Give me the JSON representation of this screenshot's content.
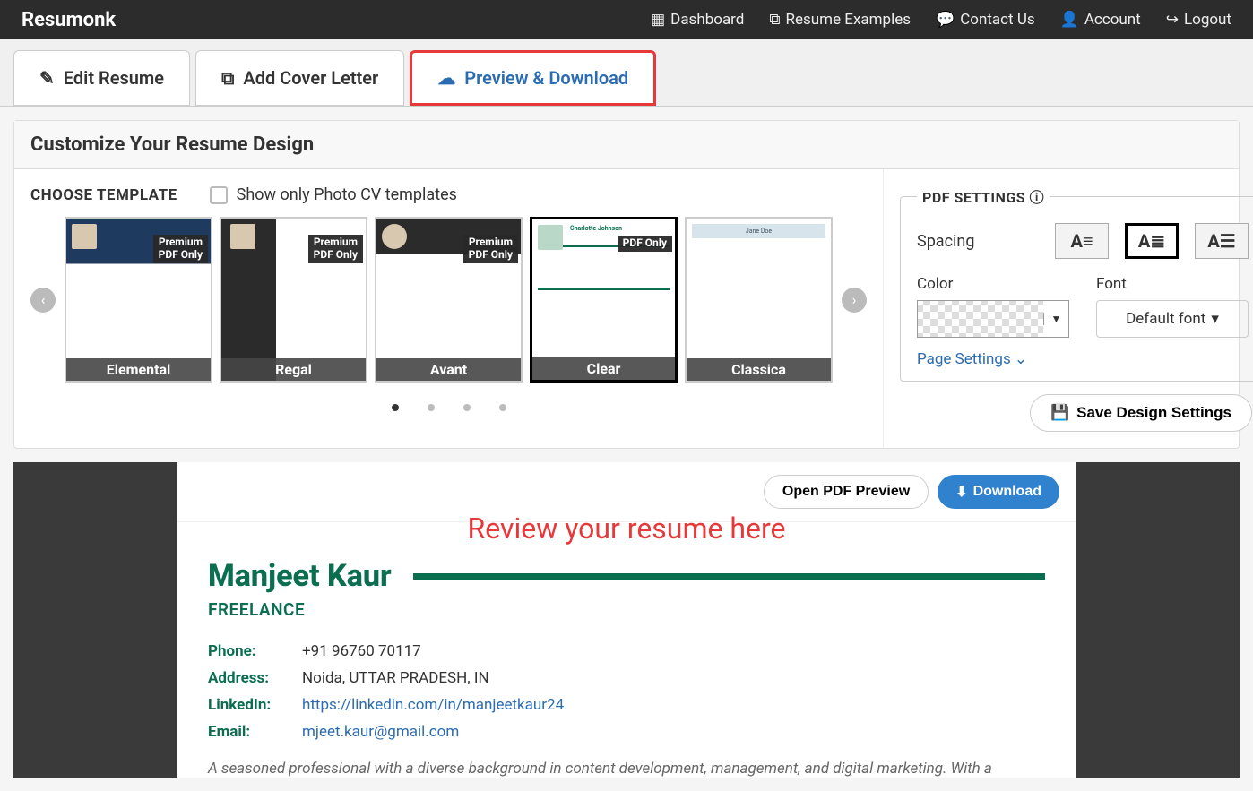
{
  "brand": "Resumonk",
  "nav": {
    "dashboard": "Dashboard",
    "examples": "Resume Examples",
    "contact": "Contact Us",
    "account": "Account",
    "logout": "Logout"
  },
  "tabs": {
    "edit": "Edit Resume",
    "cover": "Add Cover Letter",
    "preview": "Preview & Download"
  },
  "panel_title": "Customize Your Resume Design",
  "choose_template_label": "CHOOSE TEMPLATE",
  "photo_cv_checkbox": "Show only Photo CV templates",
  "templates": [
    {
      "name": "Elemental",
      "badge": "Premium\nPDF Only"
    },
    {
      "name": "Regal",
      "badge": "Premium\nPDF Only"
    },
    {
      "name": "Avant",
      "badge": "Premium\nPDF Only"
    },
    {
      "name": "Clear",
      "badge": "PDF Only",
      "selected": true
    },
    {
      "name": "Classica",
      "badge": ""
    }
  ],
  "pdf_settings_label": "PDF SETTINGS",
  "spacing_label": "Spacing",
  "color_label": "Color",
  "font_label": "Font",
  "font_value": "Default font",
  "page_settings_label": "Page Settings",
  "save_design_label": "Save Design Settings",
  "open_pdf": "Open PDF Preview",
  "download": "Download",
  "review_overlay": "Review your resume here",
  "resume": {
    "name": "Manjeet Kaur",
    "role": "FREELANCE",
    "phone_label": "Phone:",
    "phone": "+91 96760 70117",
    "address_label": "Address:",
    "address": "Noida, UTTAR PRADESH, IN",
    "linkedin_label": "LinkedIn:",
    "linkedin": "https://linkedin.com/in/manjeetkaur24",
    "email_label": "Email:",
    "email": "mjeet.kaur@gmail.com",
    "summary": "A seasoned professional with a diverse background in content development, management, and digital marketing. With a"
  }
}
